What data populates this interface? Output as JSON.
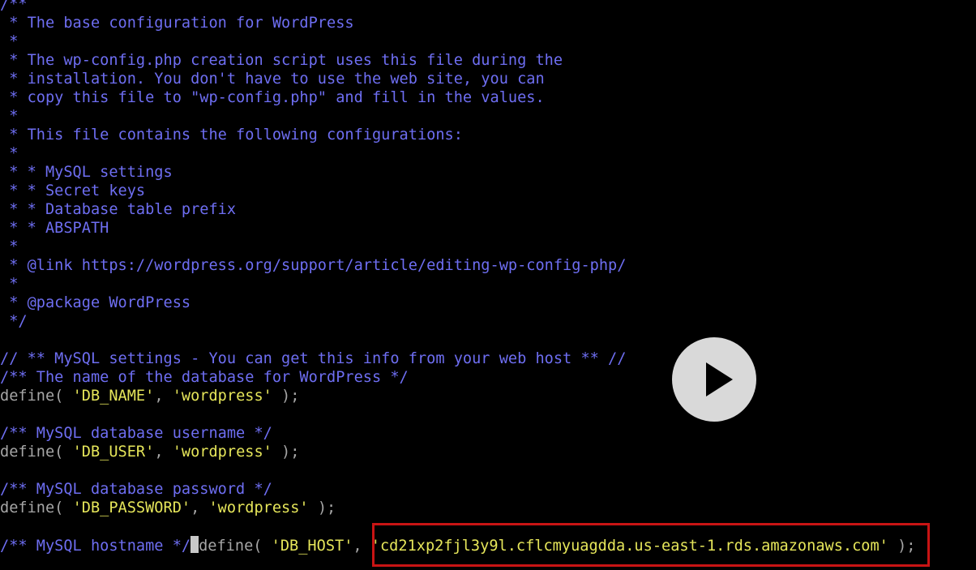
{
  "editor": {
    "header_comment": [
      "/**",
      " * The base configuration for WordPress",
      " *",
      " * The wp-config.php creation script uses this file during the",
      " * installation. You don't have to use the web site, you can",
      " * copy this file to \"wp-config.php\" and fill in the values.",
      " *",
      " * This file contains the following configurations:",
      " *",
      " * * MySQL settings",
      " * * Secret keys",
      " * * Database table prefix",
      " * * ABSPATH",
      " *",
      " * @link https://wordpress.org/support/article/editing-wp-config-php/",
      " *",
      " * @package WordPress",
      " */"
    ],
    "mysql_section_comment": "// ** MySQL settings - You can get this info from your web host ** //",
    "db_name": {
      "comment": "/** The name of the database for WordPress */",
      "define_open": "define( ",
      "key": "'DB_NAME'",
      "sep": ", ",
      "value": "'wordpress'",
      "close": " );"
    },
    "db_user": {
      "comment": "/** MySQL database username */",
      "define_open": "define( ",
      "key": "'DB_USER'",
      "sep": ", ",
      "value": "'wordpress'",
      "close": " );"
    },
    "db_password": {
      "comment": "/** MySQL database password */",
      "define_open": "define( ",
      "key": "'DB_PASSWORD'",
      "sep": ", ",
      "value": "'wordpress'",
      "close": " );"
    },
    "db_host": {
      "comment": "/** MySQL hostname */",
      "define_open": "define( ",
      "key": "'DB_HOST'",
      "sep": ", ",
      "value": "'cd21xp2fjl3y9l.cflcmyuagdda.us-east-1.rds.amazonaws.com'",
      "close": " );"
    }
  },
  "overlay": {
    "play_icon": "play-icon",
    "highlight_color": "#c81414"
  },
  "colors": {
    "background": "#000000",
    "comment": "#6e6ef2",
    "string": "#e6e65a",
    "code": "#a6a6a6"
  }
}
